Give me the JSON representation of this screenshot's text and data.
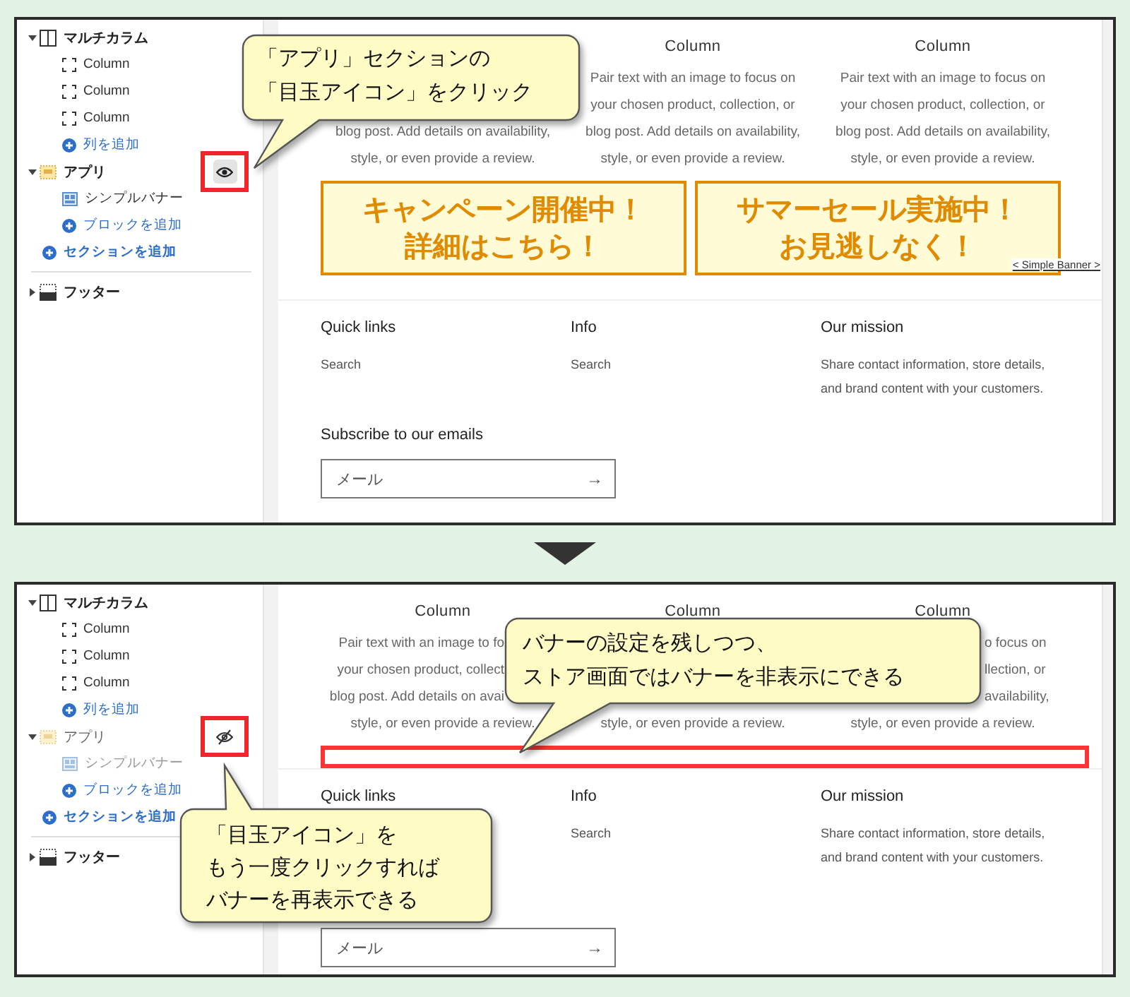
{
  "panels": [
    {
      "sidebar": {
        "sections": [
          {
            "kind": "multicolumn",
            "label": "マルチカラム",
            "expanded": true,
            "hidden": false,
            "blocks": [
              {
                "kind": "column",
                "label": "Column"
              },
              {
                "kind": "column",
                "label": "Column"
              },
              {
                "kind": "column",
                "label": "Column"
              }
            ],
            "add_label": "列を追加"
          },
          {
            "kind": "app",
            "label": "アプリ",
            "expanded": true,
            "hidden": false,
            "highlighted": true,
            "blocks": [
              {
                "kind": "banner",
                "label": "シンプルバナー"
              }
            ],
            "add_label": "ブロックを追加"
          }
        ],
        "add_section": "セクションを追加",
        "footer": {
          "label": "フッター",
          "expanded": false
        }
      },
      "content": {
        "columns": [
          {
            "lines": [
              {
                "text": "blog post. Add details on availability,",
                "cut_end": false,
                "cut_start": false
              },
              {
                "text": "style, or even provide a review.",
                "cut_end": false,
                "cut_start": false
              }
            ]
          },
          {
            "heading": "Column",
            "lines": [
              {
                "text": "Pair text with an image to focus on",
                "cut_end": false,
                "cut_start": false
              },
              {
                "text": "your chosen product, collection, or",
                "cut_end": false,
                "cut_start": false
              },
              {
                "text": "blog post. Add details on availability,",
                "cut_end": false,
                "cut_start": false
              },
              {
                "text": "style, or even provide a review.",
                "cut_end": false,
                "cut_start": false
              }
            ]
          },
          {
            "heading": "Column",
            "lines": [
              {
                "text": "Pair text with an image to focus on",
                "cut_end": false,
                "cut_start": false
              },
              {
                "text": "your chosen product, collection, or",
                "cut_end": false,
                "cut_start": false
              },
              {
                "text": "blog post. Add details on availability,",
                "cut_end": false,
                "cut_start": false
              },
              {
                "text": "style, or even provide a review.",
                "cut_end": false,
                "cut_start": false
              }
            ]
          }
        ],
        "banners": [
          {
            "lines": [
              "キャンペーン開催中！",
              "詳細はこちら！"
            ]
          },
          {
            "lines": [
              "サマーセール実施中！",
              "お見逃しなく！"
            ]
          }
        ],
        "banner_tag": "< Simple Banner >",
        "footer_columns": [
          {
            "heading": "Quick links",
            "links": [
              "Search"
            ]
          },
          {
            "heading": "Info",
            "links": [
              "Search"
            ]
          },
          {
            "heading": "Our mission",
            "lines": [
              "Share contact information, store details,",
              "and brand content with your customers."
            ]
          }
        ],
        "subscribe": {
          "heading": "Subscribe to our emails",
          "placeholder": "メール",
          "button": "→"
        }
      },
      "callouts": [
        {
          "lines": [
            "「アプリ」セクションの",
            "「目玉アイコン」をクリック"
          ]
        }
      ]
    },
    {
      "sidebar": {
        "sections": [
          {
            "kind": "multicolumn",
            "label": "マルチカラム",
            "expanded": true,
            "hidden": false,
            "blocks": [
              {
                "kind": "column",
                "label": "Column"
              },
              {
                "kind": "column",
                "label": "Column"
              },
              {
                "kind": "column",
                "label": "Column"
              }
            ],
            "add_label": "列を追加"
          },
          {
            "kind": "app",
            "label": "アプリ",
            "expanded": true,
            "hidden": true,
            "highlighted": true,
            "blocks": [
              {
                "kind": "banner",
                "label": "シンプルバナー"
              }
            ],
            "add_label": "ブロックを追加"
          }
        ],
        "add_section": "セクションを追加",
        "footer": {
          "label": "フッター",
          "expanded": false
        }
      },
      "content": {
        "columns": [
          {
            "heading": "Column",
            "lines": [
              {
                "text": "Pair text with an image to fo",
                "cut_end": true,
                "cut_start": false
              },
              {
                "text": "your chosen product, collect",
                "cut_end": true,
                "cut_start": false
              },
              {
                "text": "blog post. Add details on avai",
                "cut_end": true,
                "cut_start": false
              },
              {
                "text": "style, or even provide a review.",
                "cut_end": false,
                "cut_start": false
              }
            ]
          },
          {
            "heading": "Column",
            "lines": [
              {
                "text": "style, or even provide a review.",
                "cut_end": false,
                "cut_start": false
              }
            ]
          },
          {
            "heading": "Column",
            "lines": [
              {
                "text": "o focus on",
                "cut_end": false,
                "cut_start": true
              },
              {
                "text": "llection, or",
                "cut_end": false,
                "cut_start": true
              },
              {
                "text": "availability,",
                "cut_end": false,
                "cut_start": true
              },
              {
                "text": "style, or even provide a review.",
                "cut_end": false,
                "cut_start": false
              }
            ]
          }
        ],
        "footer_columns": [
          {
            "heading": "Quick links"
          },
          {
            "heading": "Info",
            "links": [
              "Search"
            ]
          },
          {
            "heading": "Our mission",
            "lines": [
              "Share contact information, store details,",
              "and brand content with your customers."
            ]
          }
        ],
        "subscribe": {
          "placeholder": "メール",
          "button": "→"
        }
      },
      "callouts": [
        {
          "lines": [
            "バナーの設定を残しつつ、",
            "ストア画面ではバナーを非表示にできる"
          ]
        },
        {
          "lines": [
            "「目玉アイコン」を",
            "もう一度クリックすれば",
            "バナーを再表示できる"
          ]
        }
      ]
    }
  ]
}
